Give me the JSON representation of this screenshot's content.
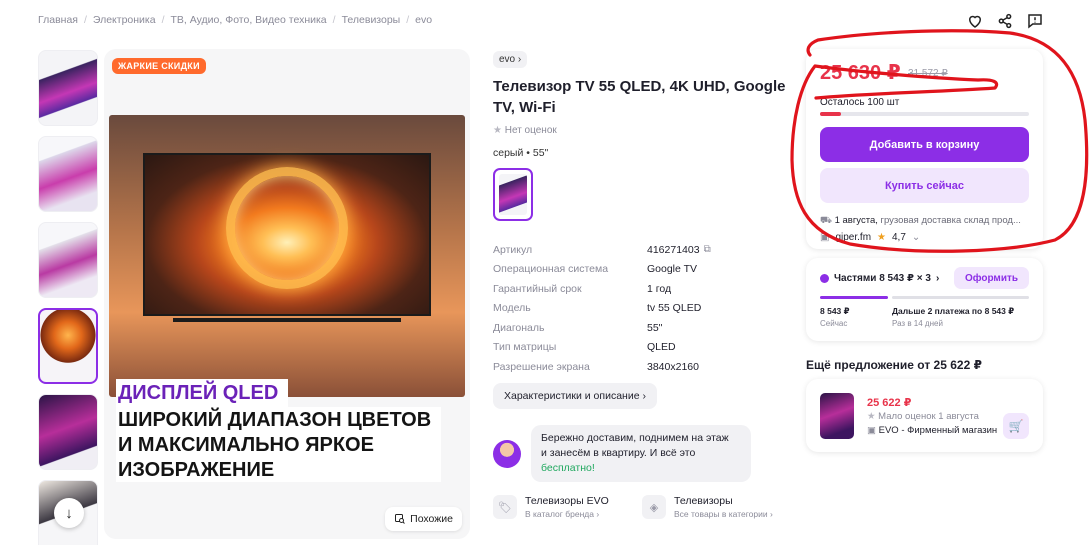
{
  "breadcrumb": [
    "Главная",
    "Электроника",
    "ТВ, Аудио, Фото, Видео техника",
    "Телевизоры",
    "evo"
  ],
  "gallery": {
    "badge": "ЖАРКИЕ СКИДКИ",
    "promo_line1": "ДИСПЛЕЙ QLED",
    "promo_line2": "ШИРОКИЙ ДИАПАЗОН ЦВЕТОВ",
    "promo_line3": "И МАКСИМАЛЬНО ЯРКОЕ",
    "promo_line4": "ИЗОБРАЖЕНИЕ",
    "similar_label": "Похожие",
    "thumb_count": 6,
    "selected_thumb": 4
  },
  "product": {
    "brand": "evo",
    "title": "Телевизор TV 55 QLED, 4K UHD, Google TV, Wi-Fi",
    "rating_text": "Нет оценок",
    "variant": "серый • 55\"",
    "specs": [
      {
        "k": "Артикул",
        "v": "416271403"
      },
      {
        "k": "Операционная система",
        "v": "Google TV"
      },
      {
        "k": "Гарантийный срок",
        "v": "1 год"
      },
      {
        "k": "Модель",
        "v": "tv 55 QLED"
      },
      {
        "k": "Диагональ",
        "v": "55\""
      },
      {
        "k": "Тип матрицы",
        "v": "QLED"
      },
      {
        "k": "Разрешение экрана",
        "v": "3840x2160"
      }
    ],
    "chars_button": "Характеристики и описание",
    "delivery_line1": "Бережно доставим, поднимем на этаж",
    "delivery_line2": "и занесём в квартиру. И всё это",
    "delivery_free": "бесплатно!",
    "categories": [
      {
        "title": "Телевизоры EVO",
        "sub": "В каталог бренда"
      },
      {
        "title": "Телевизоры",
        "sub": "Все товары в категории"
      }
    ]
  },
  "buy": {
    "price": "25 630 ₽",
    "old_price": "31 572 ₽",
    "stock": "Осталось 100 шт",
    "stock_fraction": 0.1,
    "add_to_cart": "Добавить в корзину",
    "buy_now": "Купить сейчас",
    "ship_date": "1 августа,",
    "ship_text": " грузовая доставка склад прод...",
    "seller": "giper.fm",
    "seller_rating": "4,7"
  },
  "installments": {
    "label": "Частями 8 543 ₽ × 3",
    "button": "Оформить",
    "now_amount": "8 543 ₽",
    "now_caption": "Сейчас",
    "later_amount": "Дальше 2 платежа по 8 543 ₽",
    "later_caption": "Раз в 14 дней"
  },
  "other_offer": {
    "heading": "Ещё предложение от 25 622 ₽",
    "price": "25 622 ₽",
    "meta": "Мало оценок  1 августа",
    "seller": "EVO - Фирменный магазин"
  },
  "colors": {
    "accent": "#8c2ee6",
    "price_red": "#e8334a",
    "hot_orange": "#ff6a2d",
    "annotation_red": "#e0141c"
  }
}
